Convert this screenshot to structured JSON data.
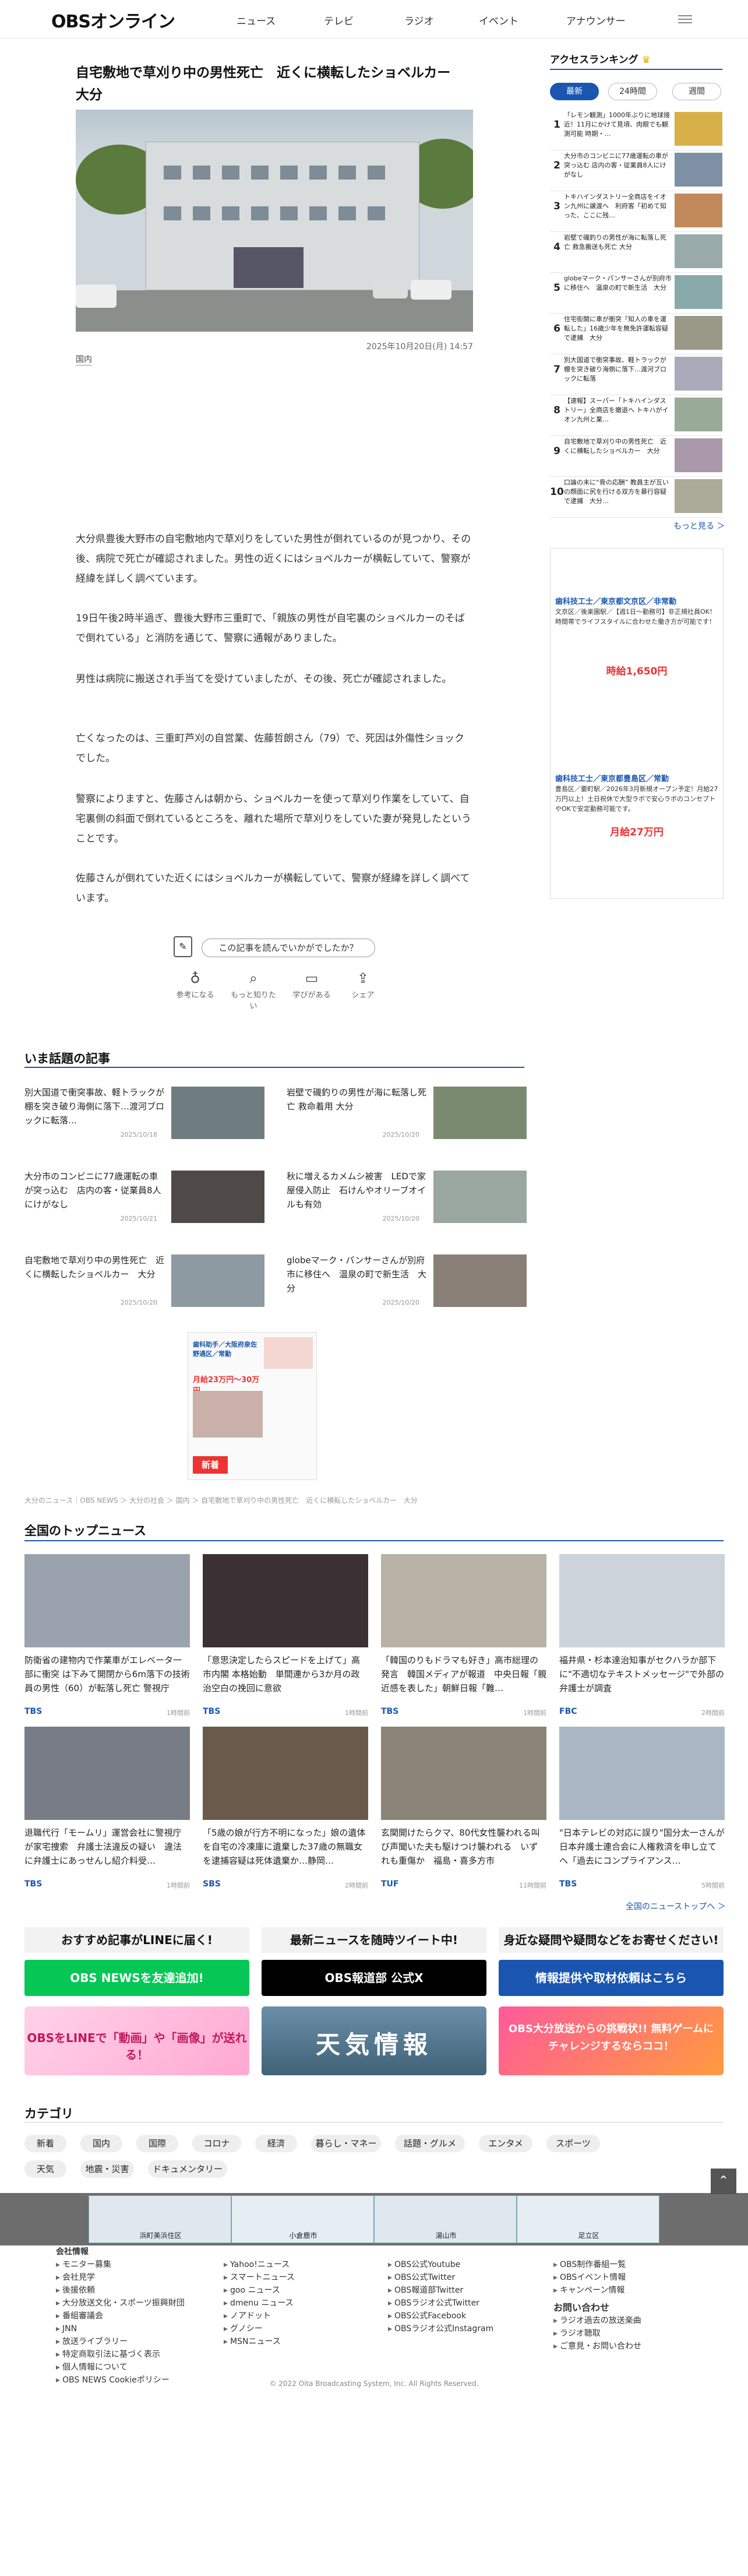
{
  "header": {
    "logo": "OBSオンライン",
    "nav": [
      "ニュース",
      "テレビ",
      "ラジオ",
      "イベント",
      "アナウンサー"
    ]
  },
  "article": {
    "title": "自宅敷地で草刈り中の男性死亡　近くに横転したショベルカー　大分",
    "date": "2025年10月20日(月) 14:57",
    "category": "国内",
    "paragraphs": [
      "大分県豊後大野市の自宅敷地内で草刈りをしていた男性が倒れているのが見つかり、その後、病院で死亡が確認されました。男性の近くにはショベルカーが横転していて、警察が経緯を詳しく調べています。",
      "19日午後2時半過ぎ、豊後大野市三重町で、「親族の男性が自宅裏のショベルカーのそばで倒れている」と消防を通じて、警察に通報がありました。",
      "男性は病院に搬送され手当てを受けていましたが、その後、死亡が確認されました。",
      "亡くなったのは、三重町芦刈の自営業、佐藤哲朗さん（79）で、死因は外傷性ショックでした。",
      "警察によりますと、佐藤さんは朝から、ショベルカーを使って草刈り作業をしていて、自宅裏側の斜面で倒れているところを、離れた場所で草刈りをしていた妻が発見したということです。",
      "佐藤さんが倒れていた近くにはショベルカーが横転していて、警察が経緯を詳しく調べています。"
    ],
    "survey_button": "この記事を読んでいかがでしたか？",
    "reactions": [
      "参考になる",
      "もっと知りたい",
      "学びがある",
      "シェア"
    ]
  },
  "ranking": {
    "title": "アクセスランキング",
    "tabs": [
      "最新",
      "24時間",
      "週間"
    ],
    "more": "もっと見る ＞",
    "items": [
      {
        "n": "1",
        "t": "「レモン観測」1000年ぶりに地球接近！11月にかけて見頃、肉眼でも観測可能 時期・…"
      },
      {
        "n": "2",
        "t": "大分市のコンビニに77歳運転の車が突っ込む 店内の客・従業員8人にけがなし"
      },
      {
        "n": "3",
        "t": "トキハインダストリー全商店をイオン九州に譲渡へ　利府客「初めて知った、ここに残…"
      },
      {
        "n": "4",
        "t": "岩壁で磯釣りの男性が海に転落し死亡 救急搬送も死亡 大分"
      },
      {
        "n": "5",
        "t": "globeマーク・パンサーさんが別府市に移住へ　温泉の町で新生活　大分"
      },
      {
        "n": "6",
        "t": "住宅街開に車が衝突「知人の車を運転した」16歳少年を無免許運転容疑で逮捕　大分"
      },
      {
        "n": "7",
        "t": "別大国道で衝突事故、軽トラックが棚を突き破り海側に落下…渡河ブロックに転落"
      },
      {
        "n": "8",
        "t": "【速報】スーパー「トキハインダストリー」全商店を撤退へ トキハがイオン九州と業…"
      },
      {
        "n": "9",
        "t": "自宅敷地で草刈り中の男性死亡　近くに横転したショベルカー　大分"
      },
      {
        "n": "10",
        "t": "口論の末に“骨の応酬” 教員主が互いの顔面に尻を行ける双方を暴行容疑で逮捕　大分…"
      }
    ]
  },
  "job_ad": {
    "a_title": "歯科技工士／東京都文京区／非常勤",
    "a_body": "文京区／後楽園駅／【週1日〜勤務可】非正規社員OK！時間帯でライフスタイルに合わせた働き方が可能です！",
    "a_price": "時給1,650円",
    "b_title": "歯科技工士／東京都豊島区／常勤",
    "b_body": "豊島区／要町駅／2026年3月新規オープン予定！月給27万円以上！土日祝休で大型ラボで安心ラボのコンセプトやOKで安定勤務可能です。",
    "b_price": "月給27万円"
  },
  "hot_topics": {
    "title": "いま話題の記事",
    "items": [
      {
        "t": "別大国道で衝突事故、軽トラックが棚を突き破り海側に落下…渡河ブロックに転落…",
        "d": "2025/10/18"
      },
      {
        "t": "岩壁で磯釣りの男性が海に転落し死亡 救命着用 大分",
        "d": "2025/10/20"
      },
      {
        "t": "大分市のコンビニに77歳運転の車が突っ込む　店内の客・従業員8人にけがなし",
        "d": "2025/10/21"
      },
      {
        "t": "秋に増えるカメムシ被害　LEDで家屋侵入防止　石けんやオリーブオイルも有効",
        "d": "2025/10/20"
      },
      {
        "t": "自宅敷地で草刈り中の男性死亡　近くに横転したショベルカー　大分",
        "d": "2025/10/20"
      },
      {
        "t": "globeマーク・パンサーさんが別府市に移住へ　温泉の町で新生活　大分",
        "d": "2025/10/20"
      }
    ]
  },
  "mid_ad": {
    "a": "歯科助手／大阪府泉佐野通区／常勤",
    "b": "月給23万円〜30万円",
    "c": "新着"
  },
  "breadcrumb": "大分のニュース｜OBS NEWS ＞ 大分の社会 ＞ 国内 ＞ 自宅敷地で草刈り中の男性死亡　近くに横転したショベルカー　大分",
  "top_news": {
    "title": "全国のトップニュース",
    "more": "全国のニューストップへ ＞",
    "items": [
      {
        "t": "防衛省の建物内で作業車がエレベータ一部に衝突 は下みて開閉から6m落下の技術員の男性（60）が転落し死亡 警視庁",
        "s": "TBS",
        "m": "1時間前"
      },
      {
        "t": "「意思決定したらスピードを上げて」高市内閣 本格始動　単間連から3か月の政治空白の挽回に意欲",
        "s": "TBS",
        "m": "1時間前"
      },
      {
        "t": "「韓国のりもドラマも好き」高市総理の発言　韓国メディアが報道　中央日報「親近感を表した」朝鮮日報「難…",
        "s": "TBS",
        "m": "1時間前"
      },
      {
        "t": "福井県・杉本達治知事がセクハラか部下に\"不適切なテキストメッセージ\"で外部の弁護士が調査",
        "s": "FBC",
        "m": "2時間前"
      },
      {
        "t": "退職代行「モームリ」運営会社に警視庁が家宅捜索　弁護士法違反の疑い　違法に弁護士にあっせんし紹介料受…",
        "s": "TBS",
        "m": "1時間前"
      },
      {
        "t": "「5歳の娘が行方不明になった」娘の遺体を自宅の冷凍庫に遺棄した37歳の無職女を逮捕容疑は死体遺棄か…静岡…",
        "s": "SBS",
        "m": "2時間前"
      },
      {
        "t": "玄関開けたらクマ、80代女性襲われる叫び声聞いた夫も駆けつけ襲われる　いずれも重傷か　福島・喜多方市",
        "s": "TUF",
        "m": "11時間前"
      },
      {
        "t": "\"日本テレビの対応に誤り\"国分太一さんが日本弁護士連合会に人権救済を申し立てへ「過去にコンプライアンス…",
        "s": "TBS",
        "m": "5時間前"
      }
    ]
  },
  "promos": [
    {
      "h": "おすすめ記事がLINEに届く!",
      "b": "OBS NEWSを友達追加!",
      "color": "#06c755"
    },
    {
      "h": "最新ニュースを随時ツイート中!",
      "b": "OBS報道部 公式X",
      "color": "#000000"
    },
    {
      "h": "身近な疑問や疑問などをお寄せください!",
      "b": "情報提供や取材依頼はこちら",
      "color": "#1a56b0"
    }
  ],
  "banners": {
    "line": "OBSをLINEで「動画」や「画像」が送れる！",
    "weather": "天気情報",
    "game": "OBS大分放送からの挑戦状!! 無料ゲームにチャレンジするならココ！"
  },
  "categories": {
    "title": "カテゴリ",
    "items": [
      "新着",
      "国内",
      "国際",
      "コロナ",
      "経済",
      "暮らし・マネー",
      "話題・グルメ",
      "エンタメ",
      "スポーツ",
      "天気",
      "地震・災害",
      "ドキュメンタリー"
    ]
  },
  "map_ad": [
    "浜町美浜住区",
    "小倉鹿市",
    "湯山市",
    "足立区"
  ],
  "footer": {
    "col1_title": "会社情報",
    "col1": [
      "モニター募集",
      "会社見学",
      "後援依頼",
      "大分放送文化・スポーツ振興財団",
      "番組審議会",
      "JNN",
      "放送ライブラリー",
      "特定商取引法に基づく表示",
      "個人情報について",
      "OBS NEWS Cookieポリシー"
    ],
    "col2": [
      "Yahoo!ニュース",
      "スマートニュース",
      "goo ニュース",
      "dmenu ニュース",
      "ノアドット",
      "グノシー",
      "MSNニュース"
    ],
    "col3": [
      "OBS公式Youtube",
      "OBS公式Twitter",
      "OBS報道部Twitter",
      "OBSラジオ公式Twitter",
      "OBS公式Facebook",
      "OBSラジオ公式Instagram"
    ],
    "col4": [
      "OBS制作番組一覧",
      "OBSイベント情報",
      "キャンペーン情報"
    ],
    "col4_title": "お問い合わせ",
    "col4b": [
      "ラジオ過去の放送楽曲",
      "ラジオ聴取",
      "ご意見・お問い合わせ"
    ],
    "copyright": "© 2022 Oita Broadcasting System, Inc. All Rights Reserved."
  }
}
